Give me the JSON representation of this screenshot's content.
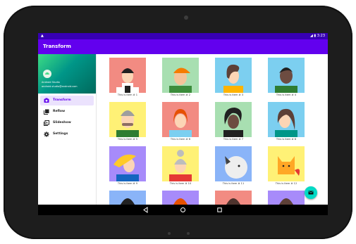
{
  "status_bar": {
    "left_icon": "warning-icon",
    "time": "3:23"
  },
  "app_bar": {
    "title": "Transform"
  },
  "drawer": {
    "user_name": "Android Studio",
    "user_email": "android.studio@android.com",
    "items": [
      {
        "label": "Transform",
        "icon": "transform-icon",
        "active": true
      },
      {
        "label": "Reflow",
        "icon": "reflow-icon",
        "active": false
      },
      {
        "label": "Slideshow",
        "icon": "slideshow-icon",
        "active": false
      },
      {
        "label": "Settings",
        "icon": "gear-icon",
        "active": false
      }
    ]
  },
  "grid": {
    "items": [
      {
        "caption": "This is item # 1",
        "bg": "#f28b82"
      },
      {
        "caption": "This is item # 2",
        "bg": "#a8dfb1"
      },
      {
        "caption": "This is item # 3",
        "bg": "#7ccff0"
      },
      {
        "caption": "This is item # 4",
        "bg": "#7ccff0"
      },
      {
        "caption": "This is item # 5",
        "bg": "#fff176"
      },
      {
        "caption": "This is item # 6",
        "bg": "#f28b82"
      },
      {
        "caption": "This is item # 7",
        "bg": "#a8dfb1"
      },
      {
        "caption": "This is item # 8",
        "bg": "#7ccff0"
      },
      {
        "caption": "This is item # 9",
        "bg": "#a78bfa"
      },
      {
        "caption": "This is item # 10",
        "bg": "#fff176"
      },
      {
        "caption": "This is item # 11",
        "bg": "#8ab4f8"
      },
      {
        "caption": "This is item # 12",
        "bg": "#fff176"
      },
      {
        "caption": "",
        "bg": "#8ab4f8"
      },
      {
        "caption": "",
        "bg": "#a78bfa"
      },
      {
        "caption": "",
        "bg": "#f28b82"
      },
      {
        "caption": "",
        "bg": "#a78bfa"
      }
    ]
  },
  "fab": {
    "icon": "email-icon"
  },
  "nav_bar": {
    "back": "back-icon",
    "home": "home-icon",
    "recents": "recents-icon"
  }
}
